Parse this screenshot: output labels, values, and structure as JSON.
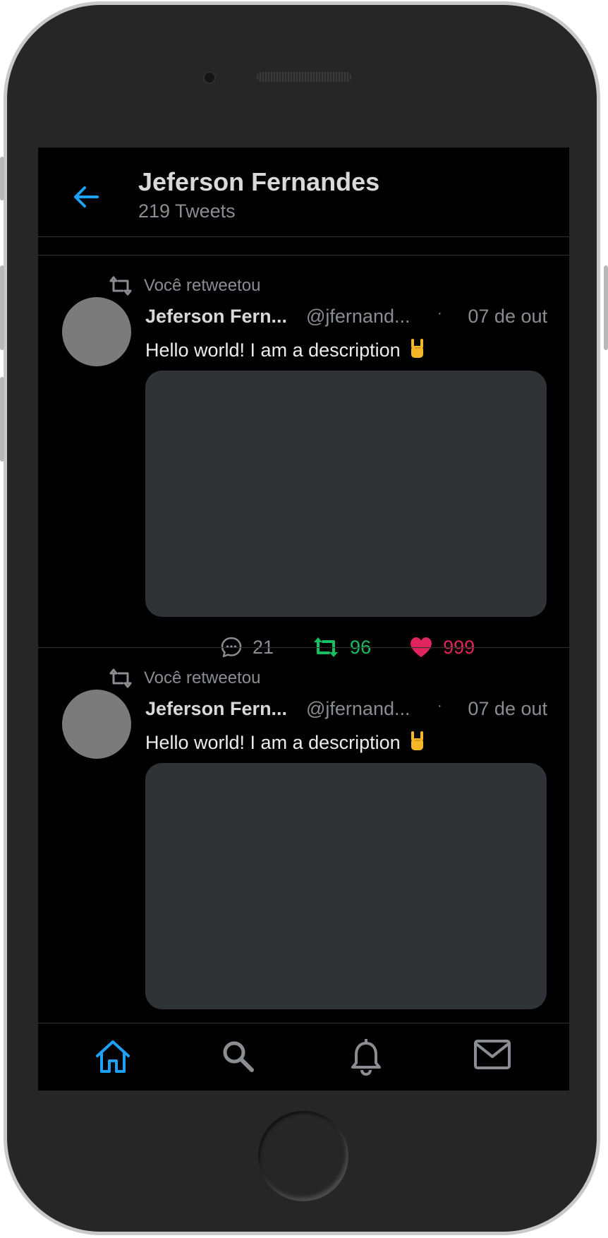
{
  "header": {
    "title": "Jeferson Fernandes",
    "subtitle": "219 Tweets"
  },
  "tweets": [
    {
      "retweet_label": "Você retweetou",
      "author_name": "Jeferson Fern...",
      "author_handle": "@jfernand...",
      "separator": "·",
      "date": "07 de out",
      "text": "Hello world! I am a description",
      "emoji": "🤘",
      "reply_count": "21",
      "retweet_count": "96",
      "like_count": "999"
    },
    {
      "retweet_label": "Você retweetou",
      "author_name": "Jeferson Fern...",
      "author_handle": "@jfernand...",
      "separator": "·",
      "date": "07 de out",
      "text": "Hello world! I am a description",
      "emoji": "🤘"
    }
  ],
  "tabbar": {
    "items": [
      {
        "icon": "home-icon",
        "active": true
      },
      {
        "icon": "search-icon",
        "active": false
      },
      {
        "icon": "bell-icon",
        "active": false
      },
      {
        "icon": "mail-icon",
        "active": false
      }
    ]
  },
  "colors": {
    "accent": "#1da1f2",
    "retweet": "#17bf63",
    "like": "#e0245e",
    "muted": "#8a8d91",
    "background": "#000000",
    "media": "#303336"
  }
}
